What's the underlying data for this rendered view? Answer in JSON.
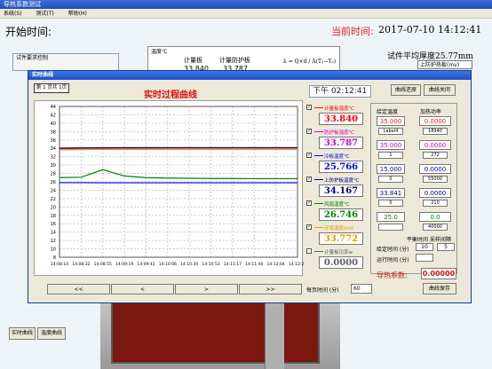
{
  "window": {
    "title": "导热系数测试"
  },
  "menu": [
    "系统(S)",
    "测试(T)",
    "帮助(H)"
  ],
  "main": {
    "start_label": "开始时间:",
    "current_label": "当前时间:",
    "current_time": "2017-07-10 14:12:41",
    "control_group": "试件要求控制",
    "temp_group": "温度℃",
    "plate1": "计量板",
    "plate1_val": "33.840",
    "plate2": "计量防护板",
    "plate2_val": "33.787",
    "formula": "λ = Q×d / A(T₁−T₂)",
    "thickness": "试件平均厚度25.77mm",
    "upper_plate": "上防护热板(mv)",
    "btn_realtime": "实时曲线",
    "btn_tempcurve": "温度曲线"
  },
  "dialog": {
    "title": "实时曲线",
    "page": "第 1 页共 1页",
    "chart_title": "实时过程曲线",
    "clock": "下午 02:12:41",
    "restore": "曲线还原",
    "close": "曲线关闭",
    "nav": [
      "<<",
      "<",
      ">",
      ">>"
    ],
    "per_page_label": "每页时间 (分)",
    "per_page": "60",
    "save": "曲线保存"
  },
  "legend": [
    {
      "label": "计量板温度℃",
      "color": "#ff0000",
      "value": "33.840",
      "check": "✓"
    },
    {
      "label": "防护板温度℃",
      "color": "#d000d0",
      "value": "33.787",
      "check": "✓"
    },
    {
      "label": "冷板温度℃",
      "color": "#0000ff",
      "value": "25.766",
      "check": "✓"
    },
    {
      "label": "上防护板温度℃",
      "color": "#000080",
      "value": "34.167",
      "check": "✓"
    },
    {
      "label": "风扇温度℃",
      "color": "#008000",
      "value": "26.746",
      "check": "✓"
    },
    {
      "label": "环境温度/mV",
      "color": "#e0a000",
      "value": "33.772",
      "check": "✓"
    },
    {
      "label": "计量板功率w",
      "color": "#606060",
      "value": "0.0000",
      "check": ""
    }
  ],
  "settings": {
    "hdr_set": "给定温度",
    "hdr_power": "加热功率",
    "rows": [
      {
        "set": "35.000",
        "set_color": "#e02020",
        "sub": "Label4",
        "pw": "0.0000",
        "pw_color": "#e02020",
        "pw2": "18940"
      },
      {
        "set": "35.000",
        "set_color": "#c000c0",
        "sub": "1",
        "pw": "0.0000",
        "pw_color": "#c000c0",
        "pw2": "272"
      },
      {
        "set": "15.000",
        "set_color": "#0000c0",
        "sub": "0",
        "pw": "0.0000",
        "pw_color": "#0000c0",
        "pw2": "55000"
      },
      {
        "set": "33.841",
        "set_color": "#000080",
        "sub": "0",
        "pw": "0.0000",
        "pw_color": "#000080",
        "pw2": "210"
      },
      {
        "set": "25.0",
        "set_color": "#008000",
        "sub": "",
        "pw": "0.0",
        "pw_color": "#008000",
        "pw2": "40000"
      }
    ],
    "interval_hdr": "平衡时间 采样间隔",
    "given_label": "给定时间 (分)",
    "given_a": "10",
    "given_b": "5",
    "run_label": "运行时间 (分)",
    "run_a": "",
    "coef_label": "导热系数:",
    "coef": "0.00000"
  },
  "chart_data": {
    "type": "line",
    "ylim": [
      8,
      44
    ],
    "yticks": [
      8,
      10,
      12,
      14,
      16,
      18,
      20,
      22,
      24,
      26,
      28,
      30,
      32,
      34,
      36,
      38,
      40,
      42,
      44
    ],
    "x": [
      "14:08:10",
      "14:08:32",
      "14:08:55",
      "14:09:19",
      "14:09:42",
      "14:10:06",
      "14:10:30",
      "14:10:53",
      "14:11:17",
      "14:11:40",
      "14:12:04",
      "14:12:27"
    ],
    "grid": true,
    "series": [
      {
        "color": "#ff0000",
        "values": [
          33.8,
          33.82,
          33.83,
          33.84,
          33.84,
          33.84,
          33.84,
          33.84,
          33.84,
          33.84,
          33.84,
          33.84
        ]
      },
      {
        "color": "#d000d0",
        "values": [
          33.7,
          33.72,
          33.75,
          33.77,
          33.78,
          33.79,
          33.79,
          33.79,
          33.79,
          33.79,
          33.79,
          33.79
        ]
      },
      {
        "color": "#000080",
        "values": [
          34.05,
          34.1,
          34.13,
          34.15,
          34.16,
          34.17,
          34.17,
          34.17,
          34.17,
          34.17,
          34.17,
          34.17
        ]
      },
      {
        "color": "#e0a000",
        "values": [
          33.7,
          33.75,
          33.77,
          33.77,
          33.77,
          33.77,
          33.77,
          33.77,
          33.77,
          33.77,
          33.77,
          33.77
        ]
      },
      {
        "color": "#0000ff",
        "values": [
          25.8,
          25.8,
          25.78,
          25.77,
          25.77,
          25.77,
          25.77,
          25.77,
          25.77,
          25.77,
          25.77,
          25.77
        ]
      },
      {
        "color": "#008000",
        "values": [
          27.0,
          27.1,
          28.9,
          27.4,
          27.0,
          26.9,
          26.85,
          26.8,
          26.8,
          26.75,
          26.75,
          26.75
        ]
      }
    ]
  }
}
